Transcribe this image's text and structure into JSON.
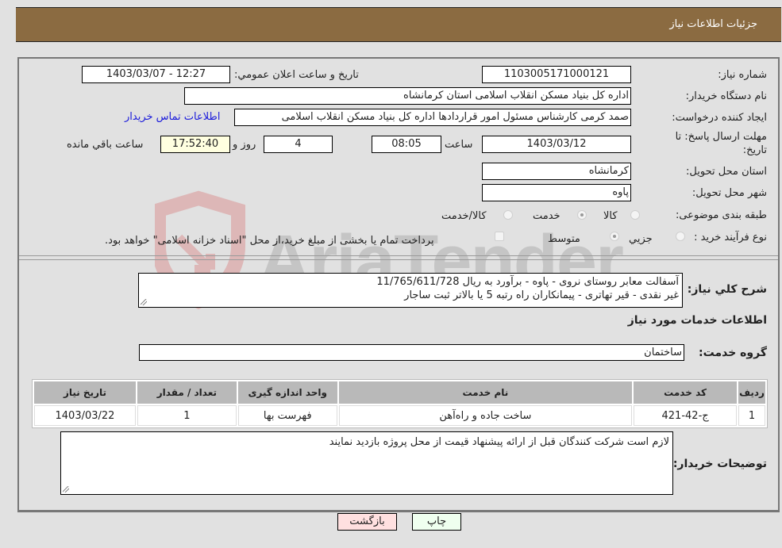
{
  "header": {
    "title": "جزئیات اطلاعات نیاز"
  },
  "fields": {
    "need_number": {
      "label": "شماره نیاز:",
      "value": "1103005171000121"
    },
    "announce_datetime": {
      "label": "تاریخ و ساعت اعلان عمومي:",
      "value": "1403/03/07 - 12:27"
    },
    "buyer_org": {
      "label": "نام دستگاه خریدار:",
      "value": "اداره کل بنیاد مسکن انقلاب اسلامی استان کرمانشاه"
    },
    "requester": {
      "label": "ایجاد کننده درخواست:",
      "value": "صمد کرمی کارشناس مسئول امور قراردادها اداره کل بنیاد مسکن انقلاب اسلامی",
      "contact_link": "اطلاعات تماس خریدار"
    },
    "deadline": {
      "label": "مهلت ارسال پاسخ: تا تاریخ:",
      "date": "1403/03/12",
      "time_label": "ساعت",
      "time": "08:05",
      "days": "4",
      "days_label": "روز و",
      "remaining": "17:52:40",
      "remaining_label": "ساعت باقي مانده"
    },
    "province": {
      "label": "استان محل تحویل:",
      "value": "کرمانشاه"
    },
    "city": {
      "label": "شهر محل تحویل:",
      "value": "پاوه"
    },
    "category": {
      "label": "طبقه بندی موضوعی:",
      "options": [
        {
          "label": "کالا",
          "checked": false
        },
        {
          "label": "خدمت",
          "checked": true
        },
        {
          "label": "کالا/خدمت",
          "checked": false
        }
      ]
    },
    "purchase_type": {
      "label": "نوع فرآیند خرید :",
      "options": [
        {
          "label": "جزيي",
          "checked": false
        },
        {
          "label": "متوسط",
          "checked": true
        }
      ],
      "treasury_checkbox": {
        "label": "پرداخت تمام یا بخشی از مبلغ خرید،از محل \"اسناد خزانه اسلامی\" خواهد بود.",
        "checked": false
      }
    }
  },
  "description": {
    "label": "شرح کلي نیاز:",
    "line1": "آسفالت معابر روستای نروی - پاوه - برآورد به ریال  11/765/611/728",
    "line2": "غیر نقدی - قیر تهاتری - پیمانکاران راه رتبه 5 یا بالاتر ثبت ساجار"
  },
  "services_section": {
    "title": "اطلاعات خدمات مورد نیاز",
    "group_label": "گروه خدمت:",
    "group_value": "ساختمان"
  },
  "table": {
    "headers": [
      "ردیف",
      "کد خدمت",
      "نام خدمت",
      "واحد اندازه گیری",
      "تعداد / مقدار",
      "تاریخ نیاز"
    ],
    "rows": [
      [
        "1",
        "ج-42-421",
        "ساخت جاده و راه‌آهن",
        "فهرست بها",
        "1",
        "1403/03/22"
      ]
    ]
  },
  "buyer_notes": {
    "label": "توضیحات خریدار:",
    "value": "لازم است شرکت کنندگان قبل از ارائه پیشنهاد قیمت از محل پروژه بازدید نمایند"
  },
  "buttons": {
    "print": "چاپ",
    "back": "بازگشت"
  },
  "watermark": {
    "text": "AriaTender.neT"
  }
}
